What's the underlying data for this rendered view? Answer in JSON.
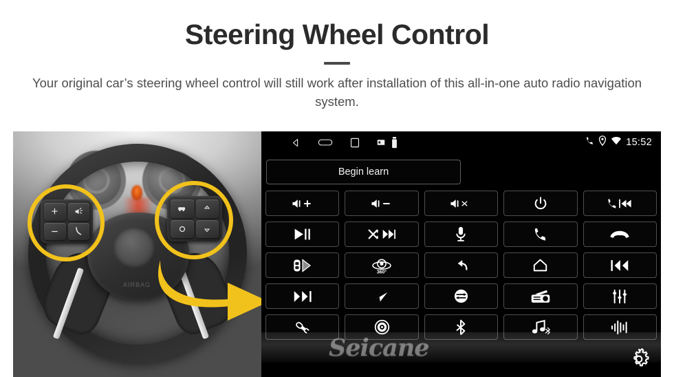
{
  "header": {
    "title": "Steering Wheel Control",
    "subtitle": "Your original car’s steering wheel control will still work after installation of this all-in-one auto radio navigation system."
  },
  "photo": {
    "alt": "car-steering-wheel-with-highlighted-control-pads",
    "airbag_label": "AIRBAG",
    "highlight_color": "#f2c21c",
    "arrow_color": "#f2c21c",
    "left_pad_keys": [
      "volume-up",
      "voice-command",
      "volume-down",
      "phone-call"
    ],
    "right_pad_keys": [
      "cruise-control",
      "arrow-up",
      "circle",
      "arrow-down"
    ]
  },
  "device": {
    "statusbar": {
      "nav_icons": [
        "back-icon",
        "home-pill-icon",
        "recents-icon",
        "sdcard-icon",
        "usb-drive-icon"
      ],
      "status_icons": [
        "phone-icon",
        "location-icon",
        "wifi-icon"
      ],
      "clock": "15:52"
    },
    "begin_learn_label": "Begin learn",
    "watermark": "Seicane",
    "settings_icon": "gear-icon",
    "buttons": [
      {
        "name": "volume-up",
        "label": "",
        "icon": "speaker-plus"
      },
      {
        "name": "volume-down",
        "label": "",
        "icon": "speaker-minus"
      },
      {
        "name": "mute",
        "label": "",
        "icon": "speaker-x"
      },
      {
        "name": "power",
        "label": "",
        "icon": "power"
      },
      {
        "name": "call-previous",
        "label": "",
        "icon": "phone-prev"
      },
      {
        "name": "play-pause",
        "label": "",
        "icon": "play-pause"
      },
      {
        "name": "shuffle-next",
        "label": "",
        "icon": "shuffle-next"
      },
      {
        "name": "voice-mic",
        "label": "",
        "icon": "microphone"
      },
      {
        "name": "answer-call",
        "label": "",
        "icon": "phone"
      },
      {
        "name": "end-call",
        "label": "",
        "icon": "phone-hangup"
      },
      {
        "name": "parking-radar",
        "label": "",
        "icon": "car-radar"
      },
      {
        "name": "panoramic-view",
        "label": "360°",
        "icon": "camera-360"
      },
      {
        "name": "back",
        "label": "",
        "icon": "back-arrow"
      },
      {
        "name": "home",
        "label": "",
        "icon": "home"
      },
      {
        "name": "previous-track",
        "label": "",
        "icon": "prev-track"
      },
      {
        "name": "next-track",
        "label": "",
        "icon": "next-track"
      },
      {
        "name": "navigation",
        "label": "",
        "icon": "navigate"
      },
      {
        "name": "source-switch",
        "label": "",
        "icon": "swap"
      },
      {
        "name": "radio",
        "label": "",
        "icon": "radio"
      },
      {
        "name": "equalizer",
        "label": "",
        "icon": "sliders"
      },
      {
        "name": "usb",
        "label": "",
        "icon": "usb-plug"
      },
      {
        "name": "dvd",
        "label": "",
        "icon": "disc"
      },
      {
        "name": "bluetooth",
        "label": "",
        "icon": "bluetooth"
      },
      {
        "name": "bluetooth-music",
        "label": "",
        "icon": "music-bt"
      },
      {
        "name": "audio-wave",
        "label": "",
        "icon": "waveform"
      }
    ]
  }
}
